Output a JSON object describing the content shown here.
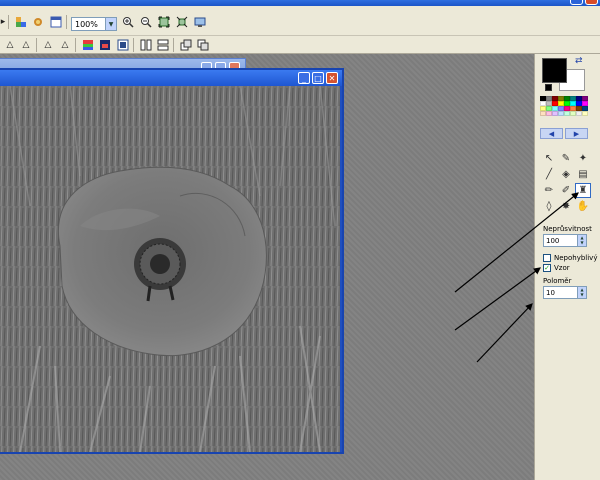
{
  "toolbar": {
    "zoom_value": "100%"
  },
  "panel": {
    "colors": {
      "primary": "#000000",
      "secondary": "#ffffff"
    },
    "palette": [
      "#000000",
      "#808080",
      "#800000",
      "#808000",
      "#008000",
      "#008080",
      "#000080",
      "#800080",
      "#ffffff",
      "#c0c0c0",
      "#ff0000",
      "#ffff00",
      "#00ff00",
      "#00ffff",
      "#0000ff",
      "#ff00ff",
      "#ffff80",
      "#80ff80",
      "#80ffff",
      "#8080ff",
      "#ff0080",
      "#ff8040",
      "#804000",
      "#004080",
      "#ffe0c0",
      "#ffc0e0",
      "#e0c0ff",
      "#c0e0ff",
      "#c0ffe0",
      "#e0ffc0",
      "#f0f0f0",
      "#ffffc0"
    ],
    "opacity_label": "Neprůsvitnost",
    "opacity_value": "100",
    "antialias_label": "Nepohyblivý",
    "antialias_checked": false,
    "pattern_label": "Vzor",
    "pattern_checked": true,
    "radius_label": "Poloměr",
    "radius_value": "10"
  }
}
